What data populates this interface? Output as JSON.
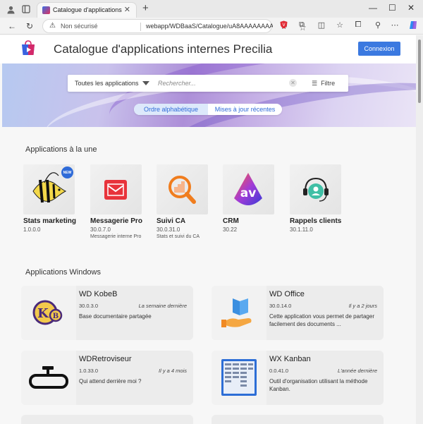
{
  "browser": {
    "tab_title": "Catalogue d'applications",
    "security_text": "Non sécurisé",
    "url": "webapp/WDBaaS/Catalogue/uA8AAAAAAAAA..."
  },
  "header": {
    "title": "Catalogue d'applications internes Precilia",
    "login_label": "Connexion"
  },
  "search": {
    "category": "Toutes les applications",
    "placeholder": "Rechercher...",
    "filter_label": "Filtre"
  },
  "sort": {
    "options": [
      "Ordre alphabétique",
      "Mises à jour récentes"
    ],
    "active": 0
  },
  "featured": {
    "title": "Applications à la une",
    "items": [
      {
        "name": "Stats marketing",
        "version": "1.0.0.0",
        "description": "",
        "badge": "NEW",
        "icon": "angelfish-icon"
      },
      {
        "name": "Messagerie Pro",
        "version": "30.0.7.0",
        "description": "Messagerie interne Pro",
        "badge": "",
        "icon": "mail-icon"
      },
      {
        "name": "Suivi CA",
        "version": "30.0.31.0",
        "description": "Stats et suivi du CA",
        "badge": "",
        "icon": "magnifier-chart-icon"
      },
      {
        "name": "CRM",
        "version": "30.22",
        "description": "",
        "badge": "",
        "icon": "crm-logo-icon"
      },
      {
        "name": "Rappels clients",
        "version": "30.1.11.0",
        "description": "",
        "badge": "",
        "icon": "headset-user-icon"
      }
    ]
  },
  "windows": {
    "title": "Applications Windows",
    "items": [
      {
        "name": "WD KobeB",
        "version": "30.0.3.0",
        "date": "La semaine dernière",
        "description": "Base documentaire partagée",
        "icon": "kb-logo-icon"
      },
      {
        "name": "WD Office",
        "version": "30.0.14.0",
        "date": "Il y a 2 jours",
        "description": "Cette application vous permet de partager facilement des documents ...",
        "icon": "hand-book-icon"
      },
      {
        "name": "WDRetroviseur",
        "version": "1.0.33.0",
        "date": "Il y a 4 mois",
        "description": "Qui attend derrière moi ?",
        "icon": "rearview-mirror-icon"
      },
      {
        "name": "WX Kanban",
        "version": "0.0.41.0",
        "date": "L'année dernière",
        "description": "Outil d'organisation utilisant la méthode Kanban.",
        "icon": "kanban-board-icon"
      }
    ]
  },
  "colors": {
    "accent": "#3b79e0",
    "card_bg": "#ececec",
    "page_bg": "#f7f7f7"
  }
}
